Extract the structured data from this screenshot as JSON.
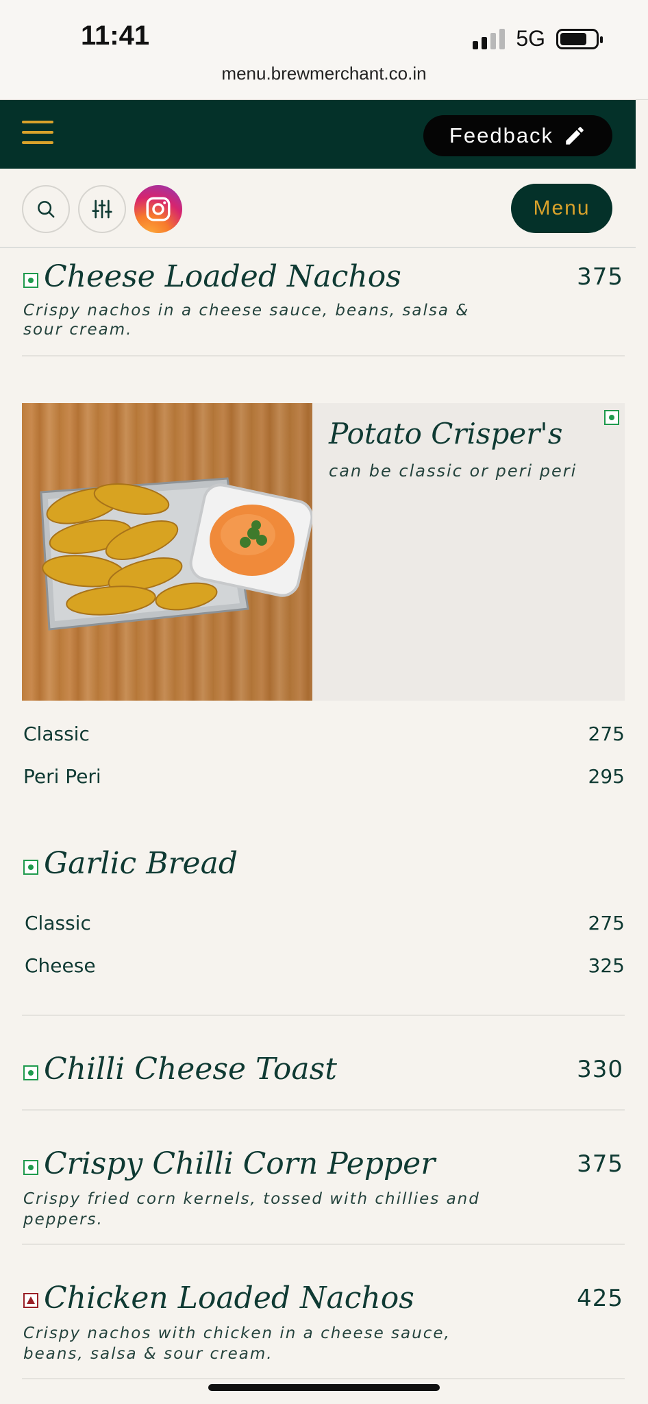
{
  "status": {
    "time": "11:41",
    "network": "5G",
    "url": "menu.brewmerchant.co.in"
  },
  "header": {
    "feedback_label": "Feedback",
    "menu_label": "Menu"
  },
  "items": [
    {
      "title": "Cheese Loaded Nachos",
      "price": "375",
      "desc_line1": "Crispy nachos in a cheese sauce, beans, salsa &",
      "desc_line2": "sour cream.",
      "type": "veg"
    },
    {
      "title": "Potato Crisper's",
      "subtitle": "can be classic or peri peri",
      "type": "veg",
      "options": [
        {
          "label": "Classic",
          "price": "275"
        },
        {
          "label": "Peri Peri",
          "price": "295"
        }
      ]
    },
    {
      "title": "Garlic Bread",
      "type": "veg",
      "options": [
        {
          "label": "Classic",
          "price": "275"
        },
        {
          "label": "Cheese",
          "price": "325"
        }
      ]
    },
    {
      "title": "Chilli Cheese Toast",
      "price": "330",
      "type": "veg"
    },
    {
      "title": "Crispy Chilli Corn Pepper",
      "price": "375",
      "desc_line1": "Crispy fried corn kernels, tossed with chillies and",
      "desc_line2": "peppers.",
      "type": "veg"
    },
    {
      "title": "Chicken Loaded Nachos",
      "price": "425",
      "desc_line1": "Crispy nachos with chicken in a cheese sauce,",
      "desc_line2": "beans, salsa & sour cream.",
      "type": "non-veg"
    }
  ],
  "colors": {
    "header_bg": "#043129",
    "accent": "#d9a22b",
    "veg": "#1f9a4d",
    "nonveg": "#9a1f26",
    "page_bg": "#f6f3ee"
  }
}
